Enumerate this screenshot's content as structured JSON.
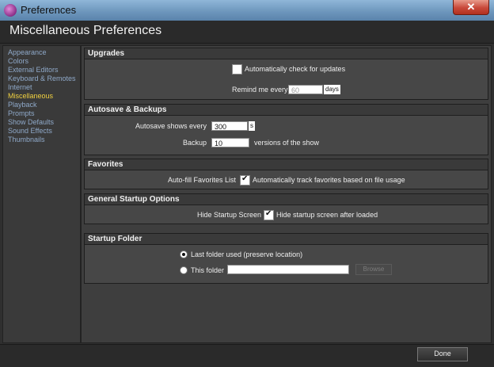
{
  "window": {
    "title": "Preferences",
    "close_icon": "✕"
  },
  "header": {
    "title": "Miscellaneous Preferences"
  },
  "sidebar": {
    "items": [
      {
        "label": "Appearance"
      },
      {
        "label": "Colors"
      },
      {
        "label": "External Editors"
      },
      {
        "label": "Keyboard & Remotes"
      },
      {
        "label": "Internet"
      },
      {
        "label": "Miscellaneous"
      },
      {
        "label": "Playback"
      },
      {
        "label": "Prompts"
      },
      {
        "label": "Show Defaults"
      },
      {
        "label": "Sound Effects"
      },
      {
        "label": "Thumbnails"
      }
    ],
    "active": "Miscellaneous"
  },
  "upgrades": {
    "title": "Upgrades",
    "auto_check_label": "Automatically check for updates",
    "auto_check": false,
    "remind_label": "Remind me every",
    "remind_value": "60",
    "remind_unit": "days"
  },
  "autosave": {
    "title": "Autosave & Backups",
    "autosave_label": "Autosave shows every",
    "autosave_value": "300",
    "autosave_unit": "s",
    "backup_label": "Backup",
    "backup_value": "10",
    "backup_suffix": "versions of the show"
  },
  "favorites": {
    "title": "Favorites",
    "label": "Auto-fill Favorites List",
    "checked": true,
    "desc": "Automatically track favorites based on file usage"
  },
  "startup": {
    "title": "General Startup Options",
    "label": "Hide Startup Screen",
    "checked": true,
    "desc": "Hide startup screen after loaded"
  },
  "folder": {
    "title": "Startup Folder",
    "last_label": "Last folder used (preserve location)",
    "this_label": "This folder",
    "this_value": "",
    "browse_label": "Browse",
    "selected": "last"
  },
  "footer": {
    "done_label": "Done"
  },
  "colors": {
    "accent_active": "#f0d040",
    "link": "#8fa9c9"
  }
}
